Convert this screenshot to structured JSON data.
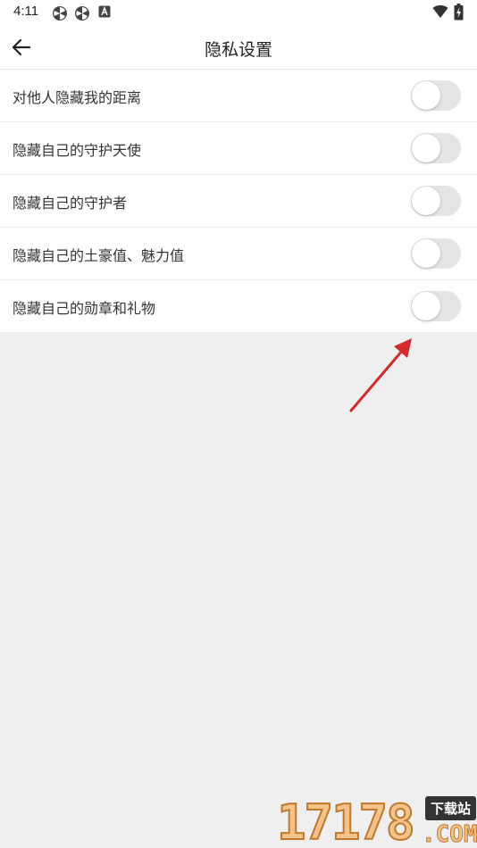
{
  "status_bar": {
    "time": "4:11",
    "icons": [
      "pinwheel-icon",
      "pinwheel-icon",
      "a-square-icon",
      "wifi-icon",
      "battery-charging-icon"
    ]
  },
  "header": {
    "title": "隐私设置",
    "back_icon": "arrow-left-icon"
  },
  "settings": [
    {
      "label": "对他人隐藏我的距离",
      "enabled": false
    },
    {
      "label": "隐藏自己的守护天使",
      "enabled": false
    },
    {
      "label": "隐藏自己的守护者",
      "enabled": false
    },
    {
      "label": "隐藏自己的土豪值、魅力值",
      "enabled": false
    },
    {
      "label": "隐藏自己的勋章和礼物",
      "enabled": false
    }
  ],
  "watermark": {
    "digits": "17178",
    "tag": "下载站",
    "suffix": ".COM"
  },
  "colors": {
    "background": "#efefef",
    "surface": "#ffffff",
    "toggle_off_track": "#e5e5e5",
    "annotation_arrow": "#d42a2a"
  }
}
